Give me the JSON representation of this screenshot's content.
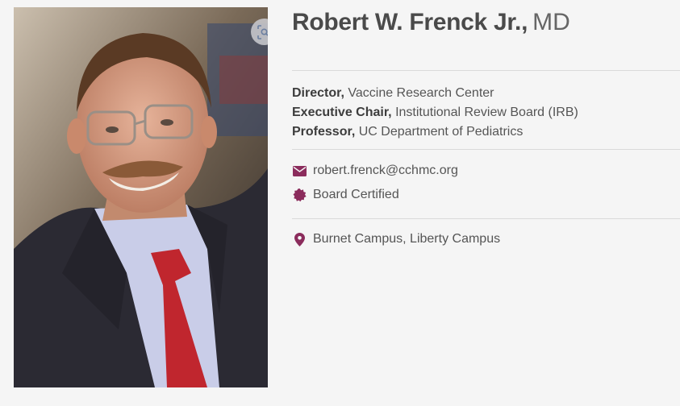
{
  "doctor": {
    "name": "Robert W. Frenck Jr.,",
    "credentials": "MD",
    "titles": [
      {
        "role": "Director,",
        "org": "Vaccine Research Center"
      },
      {
        "role": "Executive Chair,",
        "org": "Institutional Review Board (IRB)"
      },
      {
        "role": "Professor,",
        "org": "UC Department of Pediatrics"
      }
    ],
    "email": "robert.frenck@cchmc.org",
    "certification": "Board Certified",
    "locations": "Burnet Campus, Liberty Campus"
  },
  "icons": {
    "zoom": "zoom-scan-icon",
    "email": "envelope-icon",
    "certification": "certificate-badge-icon",
    "location": "map-pin-icon"
  },
  "colors": {
    "accent": "#8b2c5c",
    "background": "#f5f5f5",
    "name_text": "#4a4a4a"
  }
}
